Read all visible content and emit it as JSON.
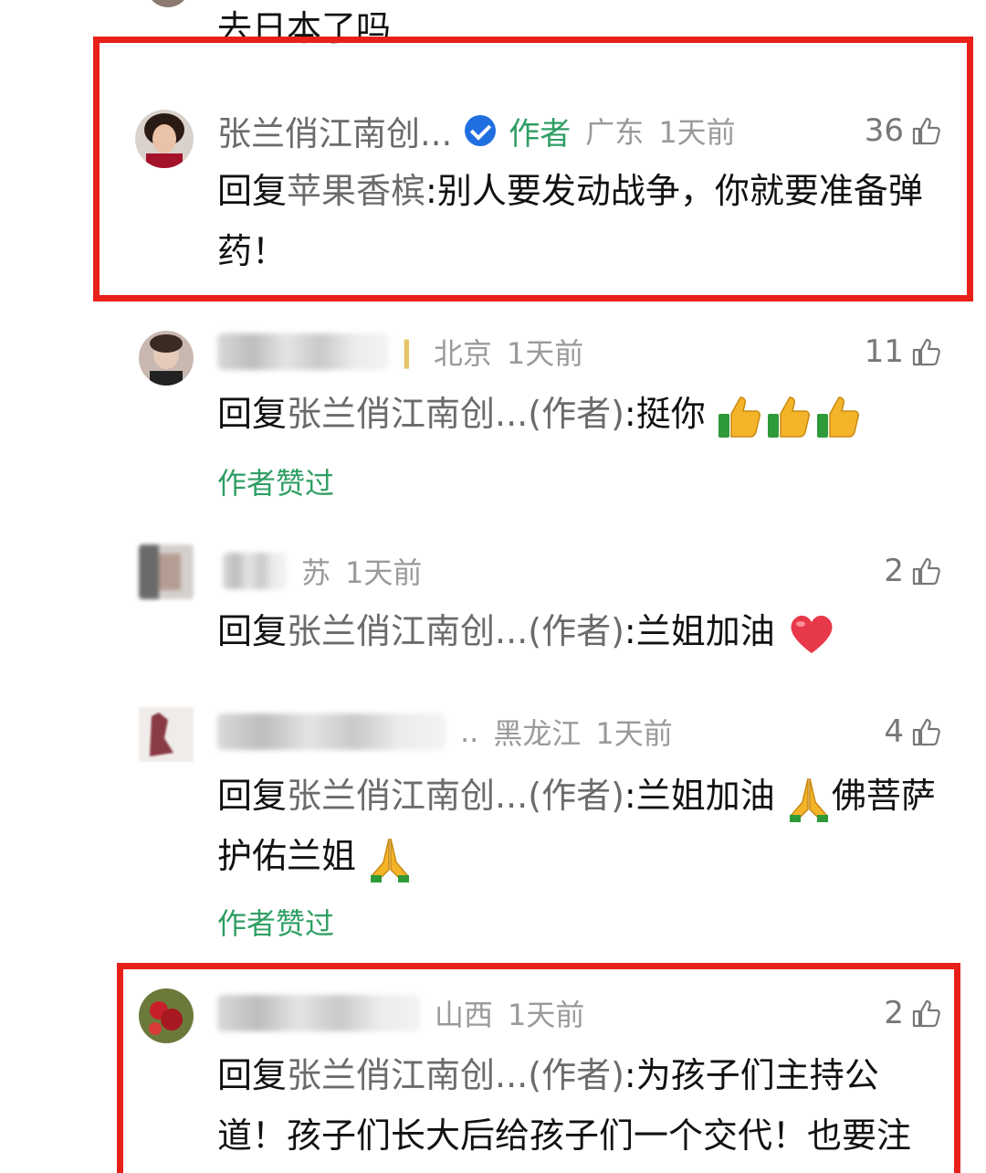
{
  "top_partial_text": "去日本了吗",
  "comments": [
    {
      "name": "张兰俏江南创...",
      "verified": true,
      "author_tag": "作者",
      "location": "广东",
      "time": "1天前",
      "likes": "36",
      "reply_prefix": "回复",
      "reply_target": "苹果香槟",
      "text": ":别人要发动战争，你就要准备弹药！"
    },
    {
      "location": "北京",
      "time": "1天前",
      "likes": "11",
      "reply_prefix": "回复",
      "reply_target": "张兰俏江南创...(作者)",
      "text": ":挺你",
      "liked_by_author": "作者赞过"
    },
    {
      "location": "苏",
      "time": "1天前",
      "likes": "2",
      "reply_prefix": "回复",
      "reply_target": "张兰俏江南创...(作者)",
      "text": ":兰姐加油"
    },
    {
      "location_prefix": "..",
      "location": "黑龙江",
      "time": "1天前",
      "likes": "4",
      "reply_prefix": "回复",
      "reply_target": "张兰俏江南创...(作者)",
      "text": ":兰姐加油",
      "text_tail": "佛菩萨护佑兰姐",
      "liked_by_author": "作者赞过"
    },
    {
      "location": "山西",
      "time": "1天前",
      "likes": "2",
      "reply_prefix": "回复",
      "reply_target": "张兰俏江南创...(作者)",
      "text": ":为孩子们主持公道！孩子们长大后给孩子们一个交代！也要注"
    }
  ],
  "colors": {
    "highlight_border": "#e8201a",
    "author_green": "#2f9e63",
    "verified_blue": "#1f6fe0",
    "meta_gray": "#9a9a9a"
  },
  "icons": [
    "thumbs-up-icon",
    "verified-badge-icon",
    "thumbs-up-emoji",
    "heart-emoji",
    "praying-hands-emoji"
  ]
}
